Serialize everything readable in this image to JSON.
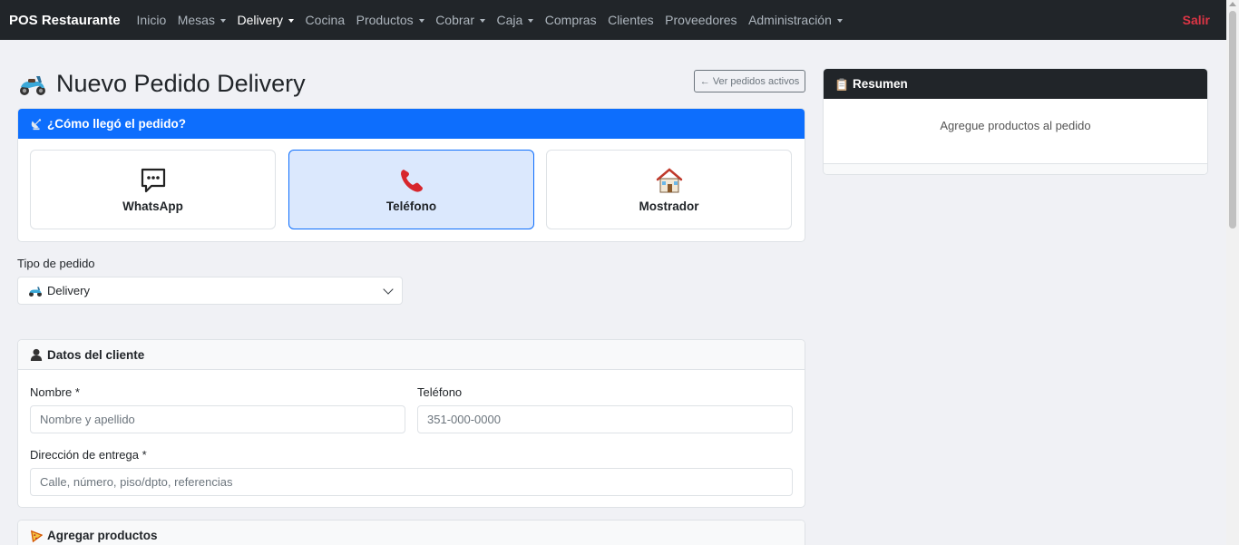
{
  "navbar": {
    "brand": "POS Restaurante",
    "items": [
      {
        "label": "Inicio",
        "dropdown": false,
        "active": false
      },
      {
        "label": "Mesas",
        "dropdown": true,
        "active": false
      },
      {
        "label": "Delivery",
        "dropdown": true,
        "active": true
      },
      {
        "label": "Cocina",
        "dropdown": false,
        "active": false
      },
      {
        "label": "Productos",
        "dropdown": true,
        "active": false
      },
      {
        "label": "Cobrar",
        "dropdown": true,
        "active": false
      },
      {
        "label": "Caja",
        "dropdown": true,
        "active": false
      },
      {
        "label": "Compras",
        "dropdown": false,
        "active": false
      },
      {
        "label": "Clientes",
        "dropdown": false,
        "active": false
      },
      {
        "label": "Proveedores",
        "dropdown": false,
        "active": false
      },
      {
        "label": "Administración",
        "dropdown": true,
        "active": false
      }
    ],
    "logout": "Salir"
  },
  "page": {
    "title": "Nuevo Pedido Delivery",
    "title_icon": "scooter-icon",
    "active_orders_button": "← Ver pedidos activos"
  },
  "origin": {
    "header": "¿Cómo llegó el pedido?",
    "header_icon": "satellite-icon",
    "options": [
      {
        "label": "WhatsApp",
        "icon": "speech-bubble-icon",
        "selected": false
      },
      {
        "label": "Teléfono",
        "icon": "phone-icon",
        "selected": true
      },
      {
        "label": "Mostrador",
        "icon": "house-icon",
        "selected": false
      }
    ]
  },
  "order_type": {
    "label": "Tipo de pedido",
    "value": "Delivery",
    "icon": "scooter-icon"
  },
  "customer": {
    "header": "Datos del cliente",
    "header_icon": "person-icon",
    "name_label": "Nombre *",
    "name_placeholder": "Nombre y apellido",
    "phone_label": "Teléfono",
    "phone_placeholder": "351-000-0000",
    "address_label": "Dirección de entrega *",
    "address_placeholder": "Calle, número, piso/dpto, referencias"
  },
  "products": {
    "header": "Agregar productos",
    "header_icon": "pizza-icon"
  },
  "summary": {
    "header": "Resumen",
    "header_icon": "clipboard-icon",
    "empty_text": "Agregue productos al pedido"
  },
  "colors": {
    "navbar_bg": "#212529",
    "primary": "#0d6efd",
    "danger": "#dc3545",
    "page_bg": "#f0f1f5"
  }
}
